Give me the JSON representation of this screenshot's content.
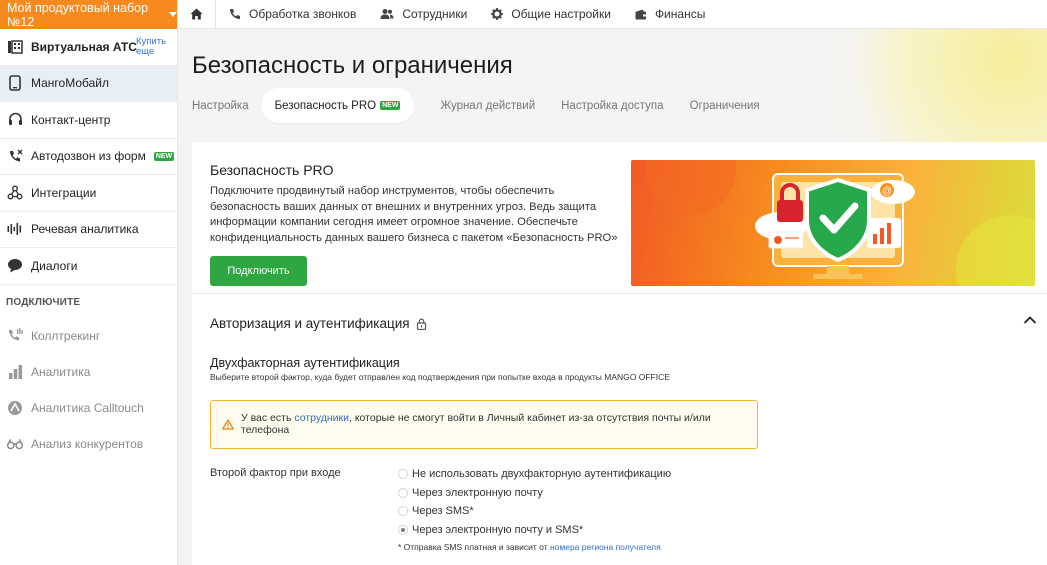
{
  "product_bar": {
    "label": "Мой продуктовый набор №12"
  },
  "sidebar": {
    "items": [
      {
        "label": "Виртуальная АТС",
        "extra": "Купить еще",
        "icon": "pbx-icon"
      },
      {
        "label": "МангоМобайл",
        "icon": "mobile-phone-icon"
      },
      {
        "label": "Контакт-центр",
        "icon": "headset-icon"
      },
      {
        "label": "Автодозвон из форм",
        "icon": "auto-call-icon",
        "badge": "NEW"
      },
      {
        "label": "Интеграции",
        "icon": "integrations-icon"
      },
      {
        "label": "Речевая аналитика",
        "icon": "voice-analytics-icon"
      },
      {
        "label": "Диалоги",
        "icon": "chat-bubble-icon"
      }
    ],
    "connect_title": "ПОДКЛЮЧИТЕ",
    "connect_items": [
      {
        "label": "Коллтрекинг",
        "icon": "calltracking-icon"
      },
      {
        "label": "Аналитика",
        "icon": "bar-chart-icon"
      },
      {
        "label": "Аналитика Calltouch",
        "icon": "calltouch-icon"
      },
      {
        "label": "Анализ конкурентов",
        "icon": "binoculars-icon"
      }
    ]
  },
  "topbar": {
    "links": [
      "Обработка звонков",
      "Сотрудники",
      "Общие настройки",
      "Финансы"
    ]
  },
  "page": {
    "title": "Безопасность и ограничения",
    "tabs": [
      "Настройка",
      "Безопасность PRO",
      "Журнал действий",
      "Настройка доступа",
      "Ограничения"
    ],
    "tab_badge": "NEW"
  },
  "pro": {
    "title": "Безопасность PRO",
    "description": "Подключите продвинутый набор инструментов, чтобы обеспечить безопасность ваших данных от внешних и внутренних угроз. Ведь защита информации компании сегодня имеет огромное значение. Обеспечьте конфиденциальность данных вашего бизнеса с пакетом «Безопасность PRO»",
    "button": "Подключить"
  },
  "auth": {
    "section_title": "Авторизация и аутентификация",
    "twofa_title": "Двухфакторная аутентификация",
    "twofa_subtitle": "Выберите второй фактор, куда будет отправлен код подтверждения при попытке входа в продукты MANGO OFFICE",
    "warning_before": "У вас есть ",
    "warning_link": "сотрудники",
    "warning_after": ", которые не смогут войти в Личный кабинет из-за отсутствия почты и/или телефона",
    "second_factor_label": "Второй фактор при входе",
    "options": [
      "Не использовать двухфакторную аутентификацию",
      "Через электронную почту",
      "Через SMS*",
      "Через электронную почту и SMS*"
    ],
    "selected_option": "Через электронную почту и SMS*",
    "note_before": "* Отправка SMS платная и зависит от ",
    "note_link": "номера региона получателя"
  },
  "colors": {
    "accent_orange": "#f68a1e",
    "green": "#2ea642",
    "link": "#2f6fc4"
  }
}
